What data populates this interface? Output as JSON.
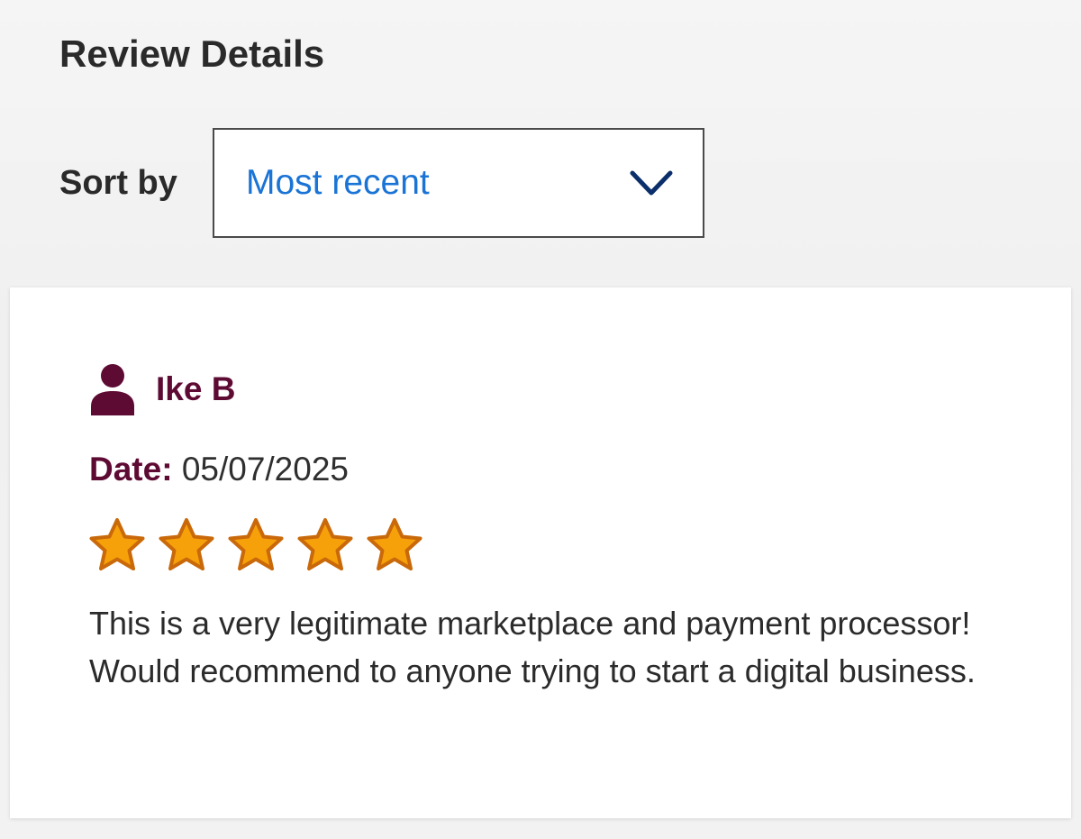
{
  "page": {
    "title": "Review Details"
  },
  "sort": {
    "label": "Sort by",
    "selected": "Most recent",
    "chevron_icon": "chevron-down-icon"
  },
  "review": {
    "reviewer_icon": "user-icon",
    "reviewer_name": "Ike B",
    "date_label": "Date:",
    "date_value": "05/07/2025",
    "rating": 5,
    "rating_max": 5,
    "star_icon": "star-icon",
    "text": "This is a very legitimate marketplace and payment processor! Would recommend to anyone trying to start a digital business."
  },
  "colors": {
    "accent_maroon": "#5e0b34",
    "link_blue": "#1a74d6",
    "chevron_navy": "#0b2f6b",
    "star_fill": "#f7a10a",
    "star_stroke": "#c9690a"
  }
}
